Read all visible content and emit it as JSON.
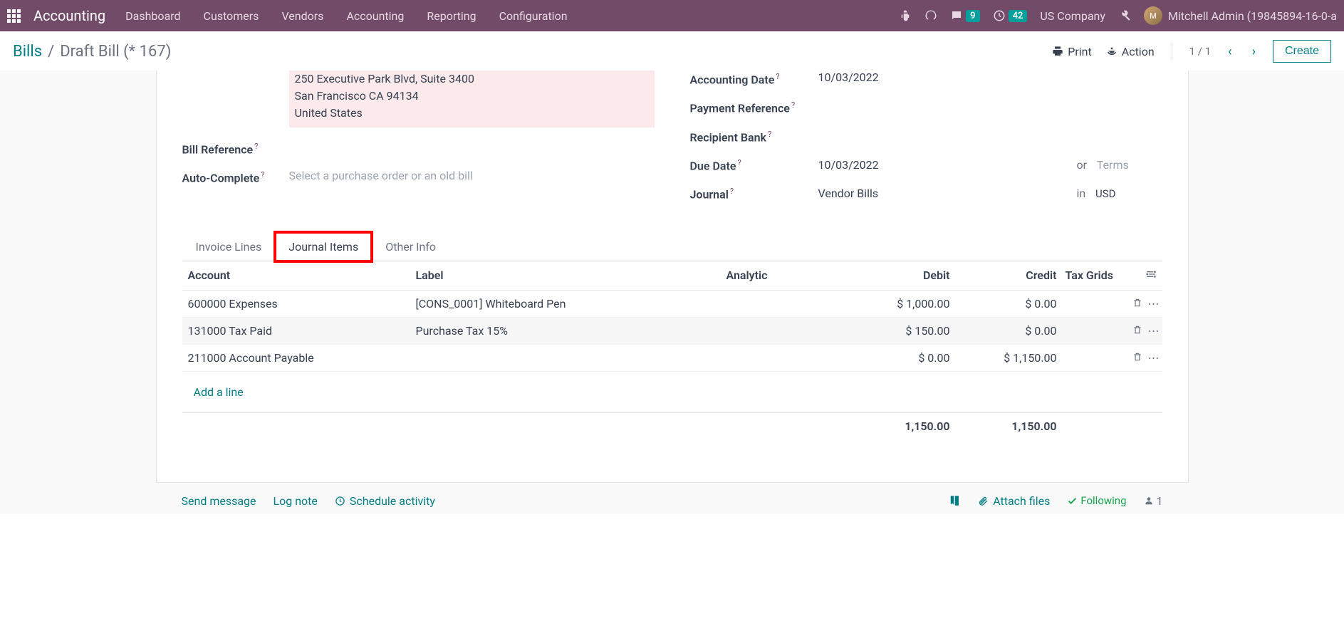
{
  "navbar": {
    "brand": "Accounting",
    "menu": [
      "Dashboard",
      "Customers",
      "Vendors",
      "Accounting",
      "Reporting",
      "Configuration"
    ],
    "chat_badge": "9",
    "timer_badge": "42",
    "company": "US Company",
    "user": "Mitchell Admin (19845894-16-0-a"
  },
  "breadcrumb": {
    "root": "Bills",
    "current": "Draft Bill (* 167)"
  },
  "actions": {
    "print": "Print",
    "action": "Action",
    "pager": "1 / 1",
    "create": "Create"
  },
  "form": {
    "address": {
      "line1": "250 Executive Park Blvd, Suite 3400",
      "line2": "San Francisco CA 94134",
      "line3": "United States"
    },
    "bill_reference_label": "Bill Reference",
    "auto_complete_label": "Auto-Complete",
    "auto_complete_placeholder": "Select a purchase order or an old bill",
    "accounting_date_label": "Accounting Date",
    "accounting_date": "10/03/2022",
    "payment_reference_label": "Payment Reference",
    "recipient_bank_label": "Recipient Bank",
    "due_date_label": "Due Date",
    "due_date": "10/03/2022",
    "or_label": "or",
    "terms_placeholder": "Terms",
    "journal_label": "Journal",
    "journal": "Vendor Bills",
    "in_label": "in",
    "currency": "USD"
  },
  "tabs": {
    "invoice_lines": "Invoice Lines",
    "journal_items": "Journal Items",
    "other_info": "Other Info"
  },
  "table": {
    "headers": {
      "account": "Account",
      "label": "Label",
      "analytic": "Analytic",
      "debit": "Debit",
      "credit": "Credit",
      "tax_grids": "Tax Grids"
    },
    "rows": [
      {
        "account": "600000 Expenses",
        "label": "[CONS_0001] Whiteboard Pen",
        "analytic": "",
        "debit": "$ 1,000.00",
        "credit": "$ 0.00",
        "tax": ""
      },
      {
        "account": "131000 Tax Paid",
        "label": "Purchase Tax 15%",
        "analytic": "",
        "debit": "$ 150.00",
        "credit": "$ 0.00",
        "tax": ""
      },
      {
        "account": "211000 Account Payable",
        "label": "",
        "analytic": "",
        "debit": "$ 0.00",
        "credit": "$ 1,150.00",
        "tax": ""
      }
    ],
    "add_line": "Add a line",
    "total_debit": "1,150.00",
    "total_credit": "1,150.00"
  },
  "chatter": {
    "send_message": "Send message",
    "log_note": "Log note",
    "schedule_activity": "Schedule activity",
    "attach_files": "Attach files",
    "following": "Following",
    "follower_count": "1"
  }
}
